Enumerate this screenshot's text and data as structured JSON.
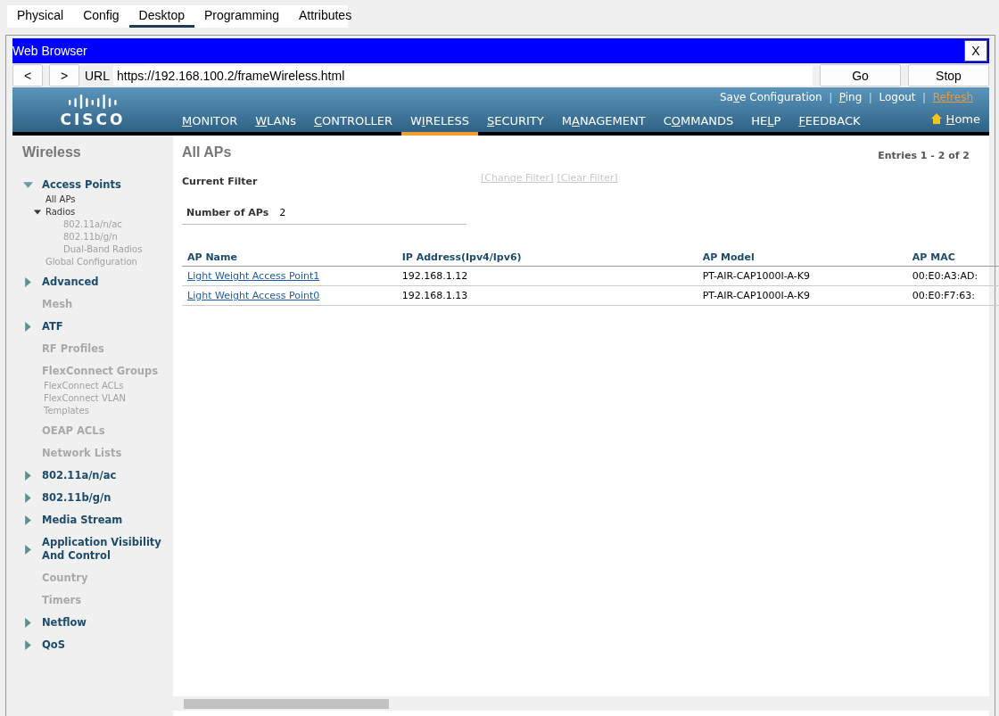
{
  "tabs": [
    {
      "label": "Physical",
      "selected": false
    },
    {
      "label": "Config",
      "selected": false
    },
    {
      "label": "Desktop",
      "selected": true
    },
    {
      "label": "Programming",
      "selected": false
    },
    {
      "label": "Attributes",
      "selected": false
    }
  ],
  "browser": {
    "title": "Web Browser",
    "close": "X",
    "back": "<",
    "forward": ">",
    "url_label": "URL",
    "url": "https://192.168.100.2/frameWireless.html",
    "go": "Go",
    "stop": "Stop"
  },
  "header": {
    "logo": "CISCO",
    "separator": "|",
    "top_links": [
      {
        "pre": "Sa",
        "key": "v",
        "post": "e Configuration",
        "highlight": false
      },
      {
        "key": "P",
        "post": "ing",
        "highlight": false
      },
      {
        "pre": "Logout",
        "highlight": false
      },
      {
        "post": "Refresh",
        "highlight": true
      }
    ],
    "menu": [
      {
        "key": "M",
        "post": "ONITOR",
        "selected": false
      },
      {
        "key": "W",
        "post": "LANs",
        "selected": false
      },
      {
        "key": "C",
        "post": "ONTROLLER",
        "selected": false
      },
      {
        "pre": "W",
        "key": "I",
        "post": "RELESS",
        "selected": true
      },
      {
        "key": "S",
        "post": "ECURITY",
        "selected": false
      },
      {
        "pre": "M",
        "key": "A",
        "post": "NAGEMENT",
        "selected": false
      },
      {
        "pre": "C",
        "key": "O",
        "post": "MMANDS",
        "selected": false
      },
      {
        "pre": "HE",
        "key": "L",
        "post": "P",
        "selected": false
      },
      {
        "key": "F",
        "post": "EEDBACK",
        "selected": false
      }
    ],
    "home": {
      "key": "H",
      "post": "ome"
    }
  },
  "sidebar": {
    "title": "Wireless",
    "items": [
      {
        "label": "Access Points",
        "disabled": false,
        "expanded": true,
        "children": [
          {
            "label": "All APs",
            "disabled": false
          },
          {
            "label": "Radios",
            "disabled": false,
            "expanded": true,
            "children": [
              {
                "label": "802.11a/n/ac",
                "disabled": true
              },
              {
                "label": "802.11b/g/n",
                "disabled": true
              },
              {
                "label": "Dual-Band Radios",
                "disabled": true
              }
            ]
          },
          {
            "label": "Global Configuration",
            "disabled": true
          }
        ]
      },
      {
        "label": "Advanced",
        "disabled": false,
        "expanded": false
      },
      {
        "label": "Mesh",
        "disabled": true
      },
      {
        "label": "ATF",
        "disabled": false,
        "expanded": false
      },
      {
        "label": "RF Profiles",
        "disabled": true
      },
      {
        "label": "FlexConnect Groups",
        "disabled": true,
        "children": [
          {
            "label": "FlexConnect ACLs",
            "disabled": true
          },
          {
            "label": "FlexConnect VLAN Templates",
            "disabled": true
          }
        ]
      },
      {
        "label": "OEAP ACLs",
        "disabled": true
      },
      {
        "label": "Network Lists",
        "disabled": true
      },
      {
        "label": "802.11a/n/ac",
        "disabled": false,
        "expanded": false
      },
      {
        "label": "802.11b/g/n",
        "disabled": false,
        "expanded": false
      },
      {
        "label": "Media Stream",
        "disabled": false,
        "expanded": false
      },
      {
        "label": "Application Visibility And Control",
        "disabled": false,
        "expanded": false
      },
      {
        "label": "Country",
        "disabled": true
      },
      {
        "label": "Timers",
        "disabled": true
      },
      {
        "label": "Netflow",
        "disabled": false,
        "expanded": false
      },
      {
        "label": "QoS",
        "disabled": false,
        "expanded": false
      }
    ]
  },
  "content": {
    "title": "All APs",
    "entries": "Entries 1 - 2 of 2",
    "filter_label": "Current Filter",
    "filter_links": [
      {
        "label": "[Change Filter]",
        "disabled": true
      },
      {
        "label": "[Clear Filter]",
        "disabled": true
      }
    ],
    "count_label": "Number of APs",
    "count": "2",
    "table": {
      "columns": [
        "AP Name",
        "IP Address(Ipv4/Ipv6)",
        "AP Model",
        "AP MAC"
      ],
      "rows": [
        [
          "Light Weight Access Point1",
          "192.168.1.12",
          "PT-AIR-CAP1000I-A-K9",
          "00:E0:A3:AD:"
        ],
        [
          "Light Weight Access Point0",
          "192.168.1.13",
          "PT-AIR-CAP1000I-A-K9",
          "00:E0:F7:63:"
        ]
      ]
    }
  }
}
